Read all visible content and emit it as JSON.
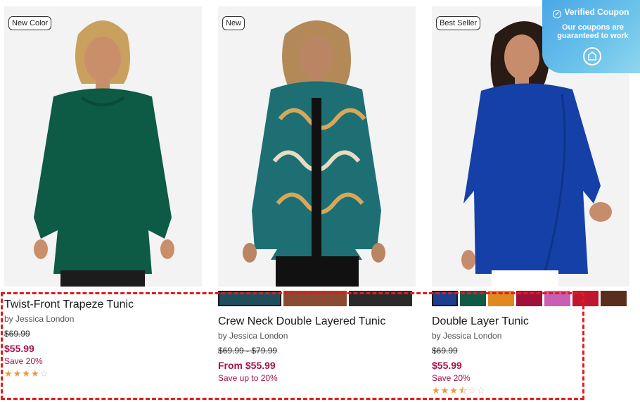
{
  "products": [
    {
      "badge": "New Color",
      "title": "Twist-Front Trapeze Tunic",
      "brand": "by Jessica London",
      "original_price": "$69.99",
      "sale_price": "$55.99",
      "save": "Save 20%",
      "rating": 4,
      "rating_max": 5,
      "stars_full": "★★★★",
      "stars_empty": "☆",
      "garment_color": "#0d5a45",
      "swatches": []
    },
    {
      "badge": "New",
      "title": "Crew Neck Double Layered Tunic",
      "brand": "by Jessica London",
      "original_price": "$69.99 - $79.99",
      "sale_price": "From $55.99",
      "save": "Save up to 20%",
      "garment_color": "#1d6f73",
      "swatches": [
        "#1f4e5a",
        "#8a4b32",
        "#2a2a2a"
      ]
    },
    {
      "badge": "Best Seller",
      "title": "Double Layer Tunic",
      "brand": "by Jessica London",
      "original_price": "$69.99",
      "sale_price": "$55.99",
      "save": "Save 20%",
      "rating": 3.5,
      "rating_max": 5,
      "stars_full": "★★★",
      "stars_half": "⯪",
      "stars_empty": "☆☆",
      "garment_color": "#1440a8",
      "swatches": [
        "#1c3e8f",
        "#0f5a47",
        "#e08a1e",
        "#a0103a",
        "#c95fb5",
        "#c0182f",
        "#5a2e1c"
      ]
    }
  ],
  "coupon": {
    "title": "Verified Coupon",
    "subtitle": "Our coupons are guaranteed to work"
  },
  "colors": {
    "accent_price": "#a3124a",
    "highlight_border": "#e31b1b",
    "coupon_bg": "#5bb4e9",
    "star": "#e89a3c"
  }
}
